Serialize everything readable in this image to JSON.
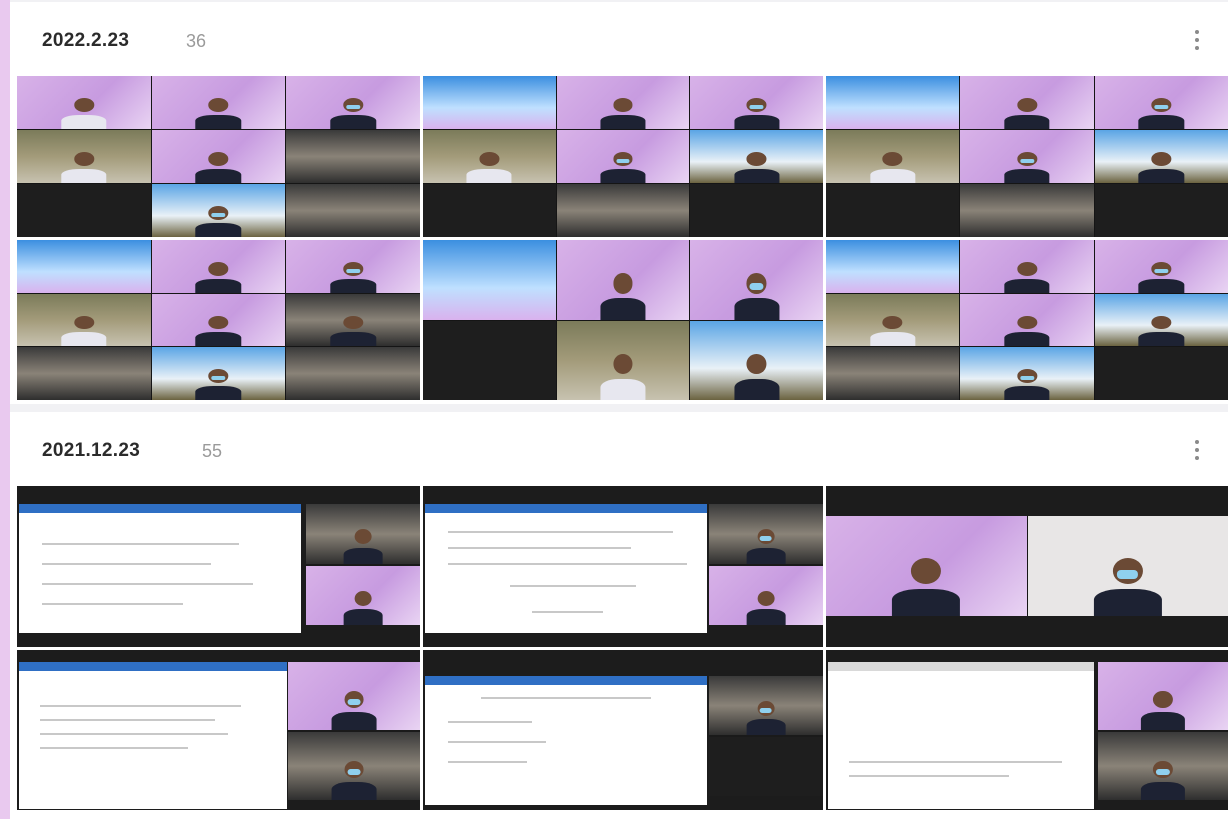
{
  "albums": [
    {
      "date": "2022.2.23",
      "count": "36"
    },
    {
      "date": "2021.12.23",
      "count": "55"
    }
  ],
  "icons": {
    "more": "more-vert-icon"
  }
}
